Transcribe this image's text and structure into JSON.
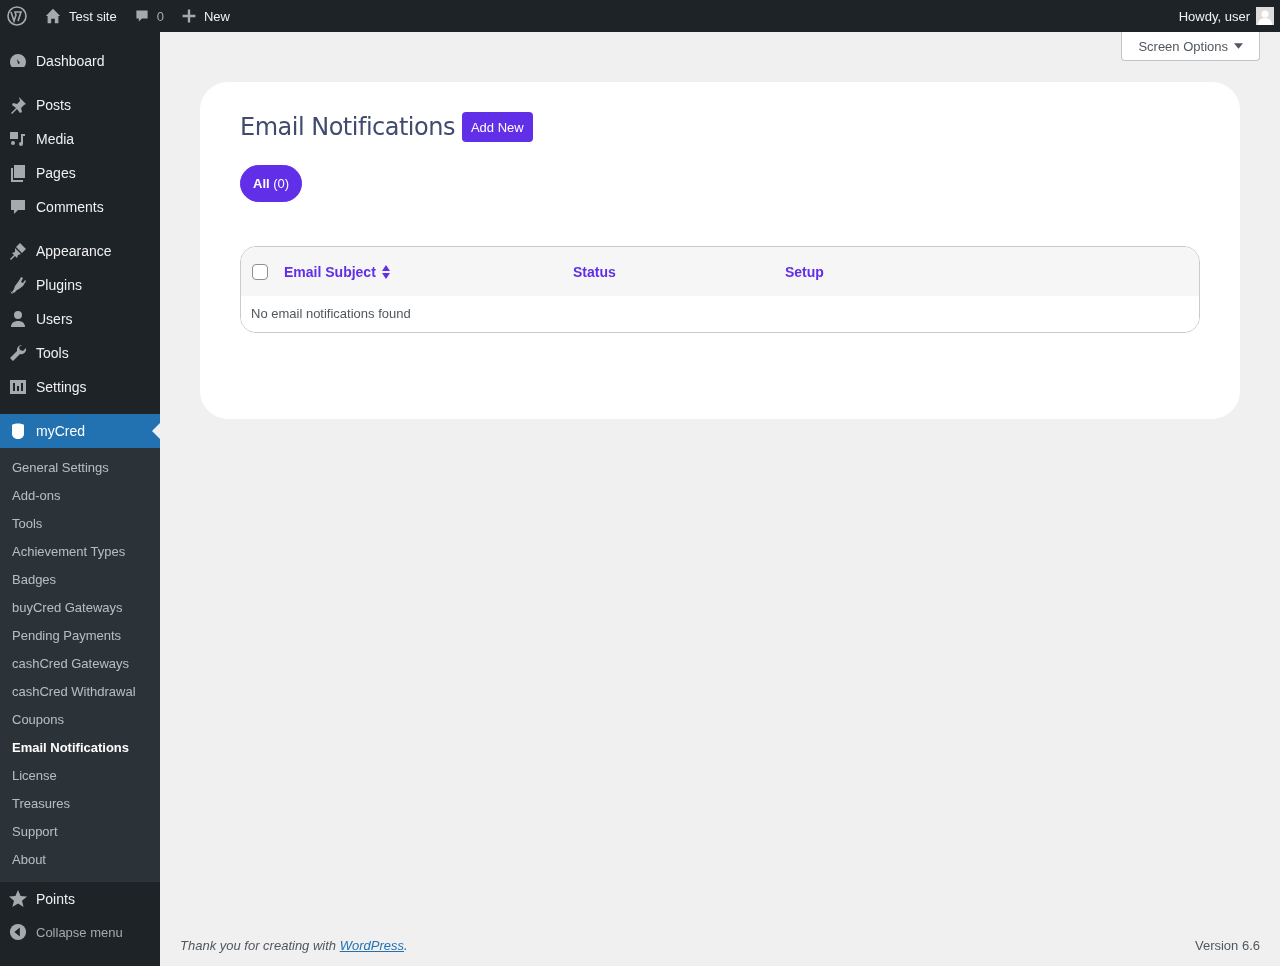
{
  "admin_bar": {
    "site_name": "Test site",
    "comments_count": "0",
    "new_label": "New",
    "greeting": "Howdy, user"
  },
  "menu": [
    {
      "items": [
        {
          "label": "Dashboard",
          "selected": false
        }
      ]
    },
    {
      "items": [
        {
          "label": "Posts",
          "selected": false
        },
        {
          "label": "Media",
          "selected": false
        },
        {
          "label": "Pages",
          "selected": false
        },
        {
          "label": "Comments",
          "selected": false
        }
      ]
    },
    {
      "items": [
        {
          "label": "Appearance",
          "selected": false
        },
        {
          "label": "Plugins",
          "selected": false
        },
        {
          "label": "Users",
          "selected": false
        },
        {
          "label": "Tools",
          "selected": false
        },
        {
          "label": "Settings",
          "selected": false
        }
      ]
    },
    {
      "items": [
        {
          "label": "myCred",
          "selected": true,
          "submenu": [
            {
              "label": "General Settings",
              "selected": false
            },
            {
              "label": "Add-ons",
              "selected": false
            },
            {
              "label": "Tools",
              "selected": false
            },
            {
              "label": "Achievement Types",
              "selected": false
            },
            {
              "label": "Badges",
              "selected": false
            },
            {
              "label": "buyCred Gateways",
              "selected": false
            },
            {
              "label": "Pending Payments",
              "selected": false
            },
            {
              "label": "cashCred Gateways",
              "selected": false
            },
            {
              "label": "cashCred Withdrawal",
              "selected": false
            },
            {
              "label": "Coupons",
              "selected": false
            },
            {
              "label": "Email Notifications",
              "selected": true
            },
            {
              "label": "License",
              "selected": false
            },
            {
              "label": "Treasures",
              "selected": false
            },
            {
              "label": "Support",
              "selected": false
            },
            {
              "label": "About",
              "selected": false
            }
          ]
        },
        {
          "label": "Points",
          "selected": false
        }
      ]
    }
  ],
  "collapse_label": "Collapse menu",
  "screen_options": "Screen Options",
  "page": {
    "title": "Email Notifications",
    "add_new": "Add New",
    "filters": [
      {
        "label": "**All** (0)",
        "selected": true
      }
    ],
    "table": {
      "select_all_checked": false,
      "columns": [
        {
          "label": "Email Subject",
          "sortable": true
        },
        {
          "label": "Status",
          "sortable": false
        },
        {
          "label": "Setup",
          "sortable": false
        }
      ],
      "empty_message": "No email notifications found"
    }
  },
  "footer": {
    "before": "Thank you for creating with ",
    "link": "WordPress",
    "after": ".",
    "version": "Version 6.6"
  }
}
